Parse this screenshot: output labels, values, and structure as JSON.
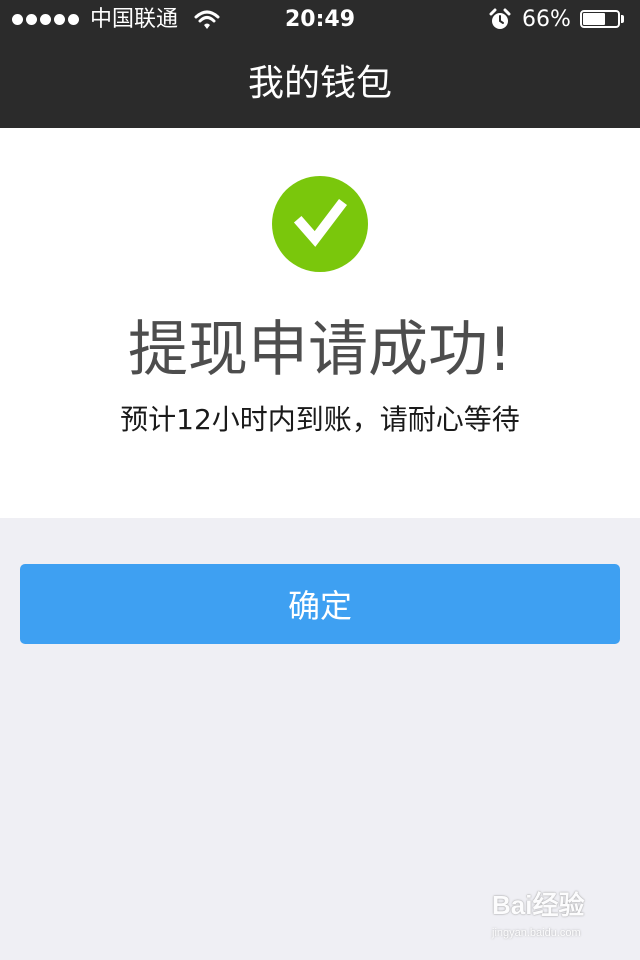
{
  "status_bar": {
    "carrier": "中国联通",
    "time": "20:49",
    "battery_percent": "66%",
    "battery_level": 0.66,
    "signal_bars": 5,
    "icons": [
      "signal-dots-icon",
      "wifi-icon",
      "alarm-icon",
      "battery-icon"
    ]
  },
  "nav": {
    "title": "我的钱包"
  },
  "result": {
    "icon": "checkmark-icon",
    "title": "提现申请成功!",
    "subtitle": "预计12小时内到账，请耐心等待"
  },
  "actions": {
    "confirm_label": "确定"
  },
  "watermark": {
    "logo": "Bai经验",
    "url": "jingyan.baidu.com"
  },
  "colors": {
    "nav_background": "#2b2b2b",
    "success_green": "#7ac70c",
    "button_blue": "#3ea0f2",
    "page_background": "#efeff4",
    "panel_background": "#ffffff"
  }
}
